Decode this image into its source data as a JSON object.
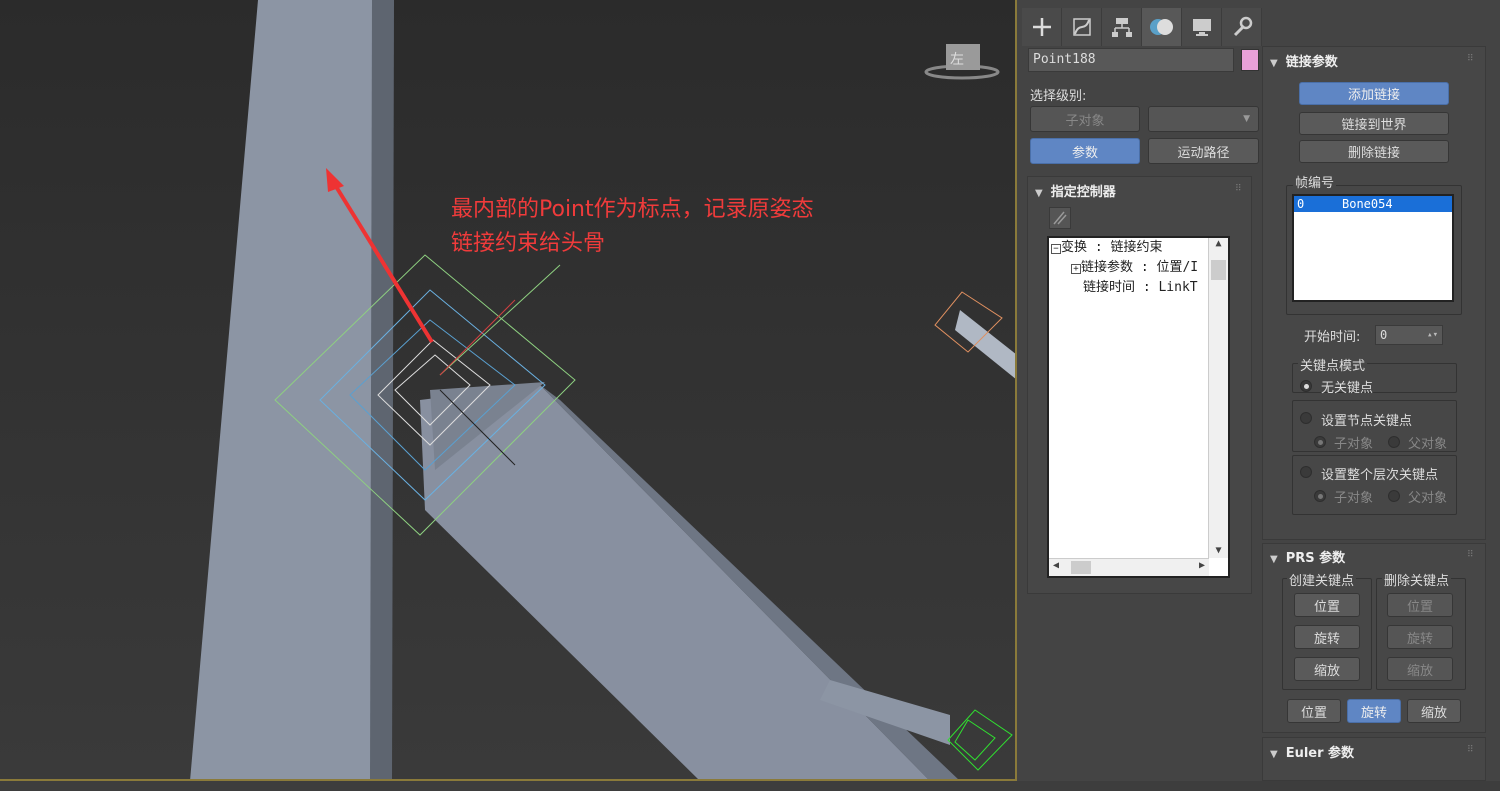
{
  "annotation": {
    "line1": "最内部的Point作为标点，记录原姿态",
    "line2": "链接约束给头骨"
  },
  "viewcube_label": "左",
  "tabs": [
    "create-icon",
    "modify-icon",
    "hierarchy-icon",
    "motion-icon",
    "display-icon",
    "utilities-icon"
  ],
  "object": {
    "name": "Point188",
    "color": "#e8a0d8"
  },
  "selection": {
    "label": "选择级别:",
    "sub_object": "子对象",
    "params": "参数",
    "motion_path": "运动路径"
  },
  "assign_controller": {
    "title": "指定控制器",
    "tree": [
      "变换 : 链接约束",
      "链接参数 : 位置/I",
      "链接时间 : LinkT"
    ]
  },
  "link_params": {
    "title": "链接参数",
    "add_link": "添加链接",
    "link_world": "链接到世界",
    "delete_link": "删除链接",
    "frame_label": "帧编号",
    "frames": [
      {
        "frame": "0",
        "target": "Bone054"
      }
    ],
    "start_time_label": "开始时间:",
    "start_time": "0",
    "key_mode_label": "关键点模式",
    "no_key": "无关键点",
    "set_node_key": "设置节点关键点",
    "set_hierarchy_key": "设置整个层次关键点",
    "child": "子对象",
    "parent": "父对象"
  },
  "prs": {
    "title": "PRS 参数",
    "create_key": "创建关键点",
    "delete_key": "删除关键点",
    "position": "位置",
    "rotation": "旋转",
    "scale": "缩放"
  },
  "euler": {
    "title": "Euler 参数"
  }
}
